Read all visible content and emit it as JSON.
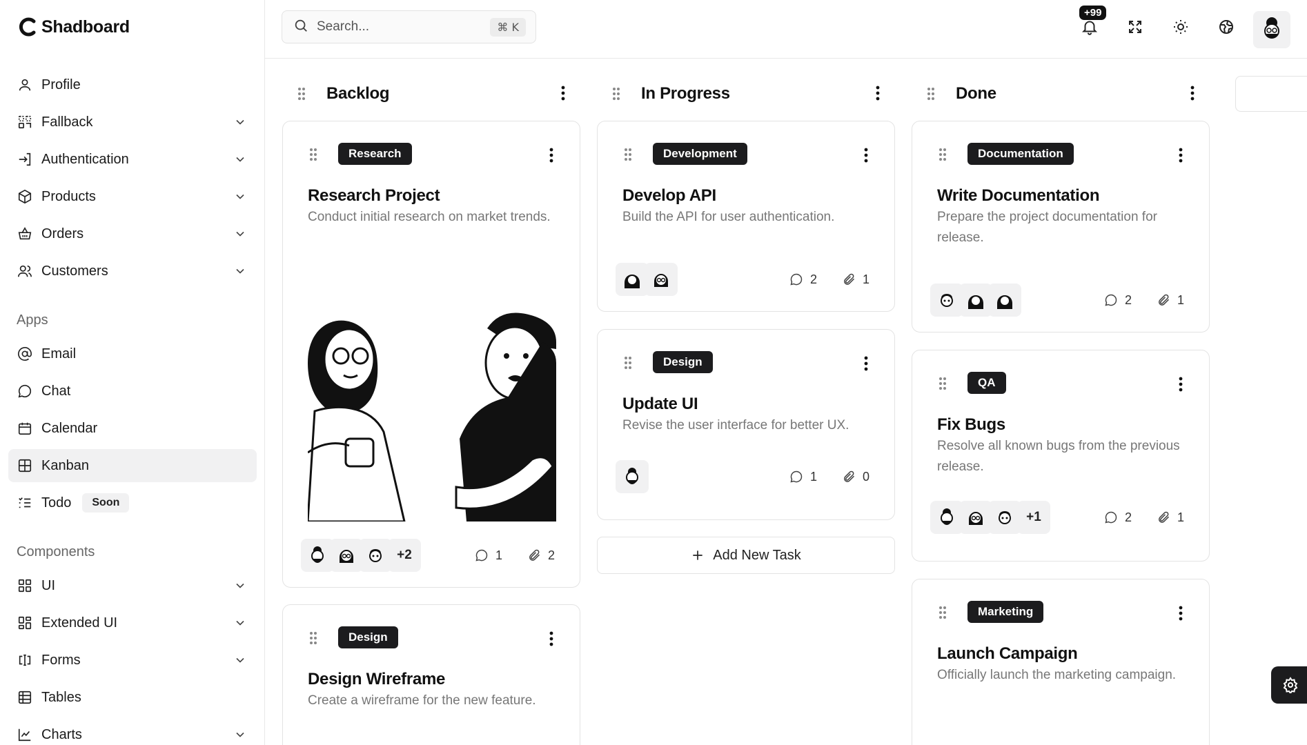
{
  "app": {
    "name": "Shadboard"
  },
  "sidebar": {
    "items": [
      {
        "label": "Profile",
        "icon": "user-icon",
        "chevron": false
      },
      {
        "label": "Fallback",
        "icon": "fallback-icon",
        "chevron": true
      },
      {
        "label": "Authentication",
        "icon": "login-icon",
        "chevron": true
      },
      {
        "label": "Products",
        "icon": "package-icon",
        "chevron": true
      },
      {
        "label": "Orders",
        "icon": "basket-icon",
        "chevron": true
      },
      {
        "label": "Customers",
        "icon": "users-icon",
        "chevron": true
      }
    ],
    "apps_label": "Apps",
    "apps": [
      {
        "label": "Email",
        "icon": "at-icon"
      },
      {
        "label": "Chat",
        "icon": "chat-icon"
      },
      {
        "label": "Calendar",
        "icon": "calendar-icon"
      },
      {
        "label": "Kanban",
        "icon": "kanban-icon",
        "active": true
      },
      {
        "label": "Todo",
        "icon": "todo-icon",
        "badge": "Soon"
      }
    ],
    "components_label": "Components",
    "components": [
      {
        "label": "UI",
        "icon": "grid-icon"
      },
      {
        "label": "Extended UI",
        "icon": "extended-grid-icon"
      },
      {
        "label": "Forms",
        "icon": "form-icon"
      },
      {
        "label": "Tables",
        "icon": "table-icon"
      },
      {
        "label": "Charts",
        "icon": "chart-icon"
      }
    ]
  },
  "header": {
    "search_placeholder": "Search...",
    "search_shortcut": "⌘ K",
    "notification_badge": "+99"
  },
  "board": {
    "columns": [
      {
        "title": "Backlog",
        "cards": [
          {
            "tag": "Research",
            "title": "Research Project",
            "description": "Conduct initial research on market trends.",
            "extra_avatars": "+2",
            "comments": "1",
            "attachments": "2"
          },
          {
            "tag": "Design",
            "title": "Design Wireframe",
            "description": "Create a wireframe for the new feature."
          }
        ]
      },
      {
        "title": "In Progress",
        "cards": [
          {
            "tag": "Development",
            "title": "Develop API",
            "description": "Build the API for user authentication.",
            "comments": "2",
            "attachments": "1"
          },
          {
            "tag": "Design",
            "title": "Update UI",
            "description": "Revise the user interface for better UX.",
            "comments": "1",
            "attachments": "0"
          }
        ],
        "add_task_label": "Add New Task"
      },
      {
        "title": "Done",
        "cards": [
          {
            "tag": "Documentation",
            "title": "Write Documentation",
            "description": "Prepare the project documentation for release.",
            "comments": "2",
            "attachments": "1"
          },
          {
            "tag": "QA",
            "title": "Fix Bugs",
            "description": "Resolve all known bugs from the previous release.",
            "extra_avatars": "+1",
            "comments": "2",
            "attachments": "1"
          },
          {
            "tag": "Marketing",
            "title": "Launch Campaign",
            "description": "Officially launch the marketing campaign."
          }
        ]
      }
    ]
  }
}
